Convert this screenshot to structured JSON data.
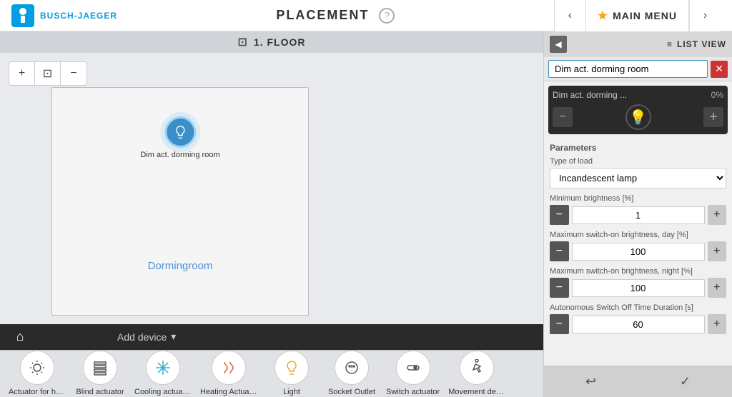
{
  "topbar": {
    "logo_text": "BUSCH-JAEGER",
    "title": "PLACEMENT",
    "help_icon": "?",
    "nav_prev": "‹",
    "nav_next": "›",
    "main_menu_label": "MAIN MENU",
    "star_icon": "★"
  },
  "floor": {
    "icon": "⊡",
    "label": "1. FLOOR"
  },
  "map": {
    "zoom_minus": "−",
    "zoom_fit": "⊡",
    "zoom_plus": "+",
    "room_label": "Dormingroom",
    "device_label": "Dim act. dorming room"
  },
  "bottom_toolbar": {
    "home_icon": "⌂",
    "add_device_label": "Add device",
    "chevron_icon": "▾"
  },
  "device_tray": {
    "items": [
      {
        "id": "actuator-heat",
        "name": "Actuator for heati...",
        "icon": "⚙"
      },
      {
        "id": "blind",
        "name": "Blind actuator",
        "icon": "☰"
      },
      {
        "id": "cooling",
        "name": "Cooling actuator",
        "icon": "❄"
      },
      {
        "id": "heating",
        "name": "Heating Actuator",
        "icon": "⊛"
      },
      {
        "id": "light",
        "name": "Light",
        "icon": "💡"
      },
      {
        "id": "socket",
        "name": "Socket Outlet",
        "icon": "⏻"
      },
      {
        "id": "switch",
        "name": "Switch actuator",
        "icon": "⚡"
      },
      {
        "id": "movement",
        "name": "Movement detect...",
        "icon": "👁"
      }
    ]
  },
  "right_panel": {
    "minimize_icon": "◀",
    "list_view_label": "LIST VIEW",
    "grid_icon": "≡",
    "search_value": "Dim act. dorming room",
    "close_icon": "✕",
    "device_card": {
      "name": "Dim act. dorming ...",
      "percent": "0%",
      "minus_icon": "−",
      "light_icon": "💡",
      "plus_icon": "+"
    },
    "parameters": {
      "title": "Parameters",
      "type_label": "Type of load",
      "type_value": "Incandescent lamp",
      "min_brightness_label": "Minimum brightness [%]",
      "min_brightness_value": "1",
      "max_day_label": "Maximum switch-on brightness, day [%]",
      "max_day_value": "100",
      "max_night_label": "Maximum switch-on brightness, night [%]",
      "max_night_value": "100",
      "auto_off_label": "Autonomous Switch Off Time Duration [s]",
      "auto_off_value": "60",
      "minus_icon": "−",
      "plus_icon": "+"
    },
    "back_icon": "↩",
    "confirm_icon": "✓"
  }
}
